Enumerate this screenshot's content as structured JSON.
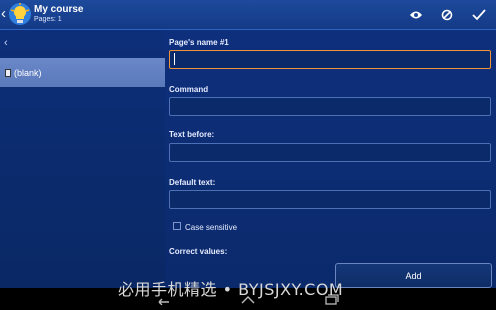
{
  "app": {
    "title": "My course",
    "subtitle": "Pages: 1",
    "icons": {
      "back": "chevron-left-icon",
      "logo": "lightbulb-logo-icon",
      "preview": "eye-icon",
      "cancel": "block-icon",
      "confirm": "check-icon"
    }
  },
  "pages": {
    "items": [
      {
        "label": "(blank)"
      }
    ]
  },
  "form": {
    "page_name_label": "Page's name #1",
    "page_name_value": "",
    "command_label": "Command",
    "command_value": "",
    "text_before_label": "Text before:",
    "text_before_value": "",
    "default_text_label": "Default text:",
    "default_text_value": "",
    "case_sensitive_label": "Case sensitive",
    "case_sensitive_checked": false,
    "correct_values_label": "Correct values:",
    "add_label": "Add"
  },
  "watermark": {
    "text": "必用手机精选 • BYJSJXY.COM"
  },
  "colors": {
    "accent": "#f0933a",
    "actionbar": "#1d4a9c",
    "selected": "#6a88c8"
  }
}
